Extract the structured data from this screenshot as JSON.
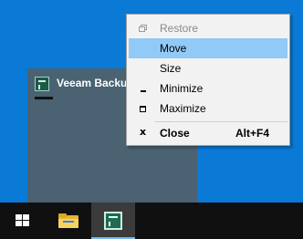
{
  "app_window": {
    "title": "Veeam Backup",
    "icon": "veeam-logo-icon"
  },
  "context_menu": {
    "items": [
      {
        "label": "Restore",
        "icon": "restore-icon",
        "enabled": false
      },
      {
        "label": "Move",
        "icon": "",
        "highlighted": true
      },
      {
        "label": "Size",
        "icon": ""
      },
      {
        "label": "Minimize",
        "icon": "minimize-icon"
      },
      {
        "label": "Maximize",
        "icon": "maximize-icon"
      },
      {
        "label": "Close",
        "icon": "close-icon",
        "shortcut": "Alt+F4"
      }
    ]
  },
  "taskbar": {
    "items": [
      {
        "icon": "windows-start-icon"
      },
      {
        "icon": "file-explorer-icon"
      },
      {
        "icon": "veeam-app-icon",
        "active": true
      }
    ]
  },
  "colors": {
    "desktop": "#0a7ad6",
    "taskbar": "#101010",
    "menu_background": "#f2f2f2",
    "menu_highlight": "#91c9f7",
    "preview_background": "#4a6271"
  }
}
